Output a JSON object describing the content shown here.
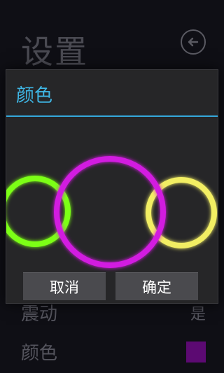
{
  "screen": {
    "title": "设置",
    "settings": [
      {
        "label": "震动",
        "value": "是"
      },
      {
        "label": "颜色",
        "swatch_color": "#5c0a72"
      }
    ]
  },
  "dialog": {
    "title": "颜色",
    "options": [
      {
        "name": "green",
        "color": "#7cff14"
      },
      {
        "name": "magenta",
        "color": "#d21ae0"
      },
      {
        "name": "yellow",
        "color": "#f2ee63"
      }
    ],
    "selected": "magenta",
    "cancel_label": "取消",
    "ok_label": "确定"
  },
  "colors": {
    "accent": "#35a8dc"
  }
}
